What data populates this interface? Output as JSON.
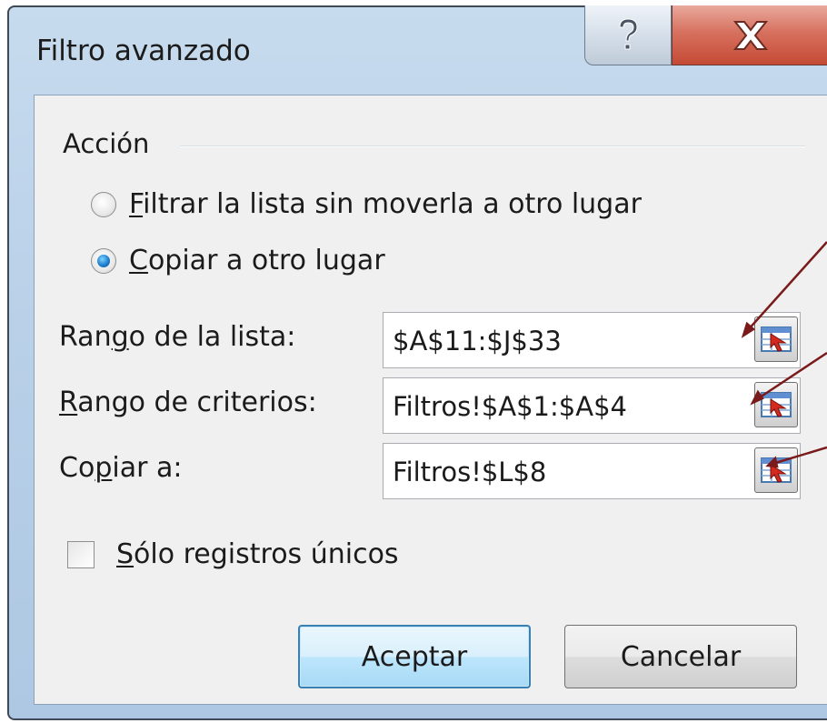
{
  "window": {
    "title": "Filtro avanzado",
    "help_icon": "question-mark-icon",
    "close_icon": "close-x-icon"
  },
  "action_group": {
    "label": "Acción",
    "options": [
      {
        "mnemonic": "F",
        "rest": "iltrar la lista sin moverla a otro lugar",
        "checked": false
      },
      {
        "mnemonic": "C",
        "rest": "opiar a otro lugar",
        "checked": true
      }
    ]
  },
  "fields": [
    {
      "label_pre": "Ran",
      "mnemonic": "g",
      "label_post": "o de la lista:",
      "value": "$A$11:$J$33",
      "ref_icon": "collapse-dialog-icon"
    },
    {
      "label_pre": "",
      "mnemonic": "R",
      "label_post": "ango de criterios:",
      "value": "Filtros!$A$1:$A$4",
      "ref_icon": "collapse-dialog-icon"
    },
    {
      "label_pre": "Co",
      "mnemonic": "p",
      "label_post": "iar a:",
      "value": "Filtros!$L$8",
      "ref_icon": "collapse-dialog-icon"
    }
  ],
  "unique_checkbox": {
    "mnemonic": "S",
    "rest": "ólo registros únicos",
    "checked": false
  },
  "buttons": {
    "ok": "Aceptar",
    "cancel": "Cancelar"
  },
  "colors": {
    "frame": "#b9d0e8",
    "close": "#c44a35",
    "callout_arrow": "#7a1a1a"
  }
}
